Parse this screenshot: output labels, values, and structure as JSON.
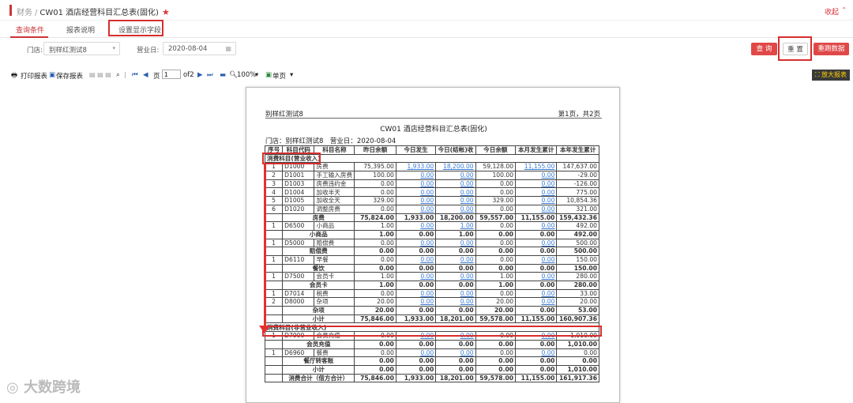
{
  "header": {
    "crumb1": "财务",
    "sep": "/",
    "title": "CW01 酒店经营科目汇总表(固化)",
    "collapse": "收起"
  },
  "tabs": [
    "查询条件",
    "报表说明",
    "设置显示字段"
  ],
  "filters": {
    "store_label": "门店:",
    "store_value": "别样红测试8",
    "date_label": "营业日:",
    "date_value": "2020-08-04"
  },
  "buttons": {
    "query": "查 询",
    "reset": "重 置",
    "rerun": "重跑数据"
  },
  "toolbar": {
    "print": "打印报表",
    "save": "保存报表",
    "page_label": "页",
    "page_value": "1",
    "of": "of2",
    "zoom": "100%",
    "single": "单页",
    "enlarge": "放大报表"
  },
  "report": {
    "store": "别样红测试8",
    "page_info": "第1页，共2页",
    "title": "CW01 酒店经营科目汇总表(固化)",
    "meta": "门店：别样红测试8　营业日：2020-08-04",
    "columns": [
      "序号",
      "科目代码",
      "科目名称",
      "昨日余额",
      "今日发生",
      "今日(结帐)收",
      "今日余额",
      "本月发生累计",
      "本年发生累计"
    ],
    "rows": [
      {
        "t": "sect",
        "label": "消费科目(营业收入)"
      },
      {
        "t": "d",
        "c": [
          "1",
          "D1000",
          "房费",
          "75,395.00",
          "1,933.00",
          "18,200.00",
          "59,128.00",
          "11,155.00",
          "147,637.00"
        ]
      },
      {
        "t": "d",
        "c": [
          "2",
          "D1001",
          "手工输入房费",
          "100.00",
          "0.00",
          "0.00",
          "100.00",
          "0.00",
          "-29.00"
        ]
      },
      {
        "t": "d",
        "c": [
          "3",
          "D1003",
          "房费违约金",
          "0.00",
          "0.00",
          "0.00",
          "0.00",
          "0.00",
          "-126.00"
        ]
      },
      {
        "t": "d",
        "c": [
          "4",
          "D1004",
          "加收半天",
          "0.00",
          "0.00",
          "0.00",
          "0.00",
          "0.00",
          "775.00"
        ]
      },
      {
        "t": "d",
        "c": [
          "5",
          "D1005",
          "加收全天",
          "329.00",
          "0.00",
          "0.00",
          "329.00",
          "0.00",
          "10,854.36"
        ]
      },
      {
        "t": "d",
        "c": [
          "6",
          "D1020",
          "调整房费",
          "0.00",
          "0.00",
          "0.00",
          "0.00",
          "0.00",
          "321.00"
        ]
      },
      {
        "t": "s",
        "label": "房费",
        "c": [
          "75,824.00",
          "1,933.00",
          "18,200.00",
          "59,557.00",
          "11,155.00",
          "159,432.36"
        ]
      },
      {
        "t": "d",
        "c": [
          "1",
          "D6500",
          "小商品",
          "1.00",
          "0.00",
          "1.00",
          "0.00",
          "0.00",
          "492.00"
        ]
      },
      {
        "t": "s",
        "label": "小商品",
        "c": [
          "1.00",
          "0.00",
          "1.00",
          "0.00",
          "0.00",
          "492.00"
        ]
      },
      {
        "t": "d",
        "c": [
          "1",
          "D5000",
          "赔偿费",
          "0.00",
          "0.00",
          "0.00",
          "0.00",
          "0.00",
          "500.00"
        ]
      },
      {
        "t": "s",
        "label": "赔偿费",
        "c": [
          "0.00",
          "0.00",
          "0.00",
          "0.00",
          "0.00",
          "500.00"
        ]
      },
      {
        "t": "d",
        "c": [
          "1",
          "D6110",
          "早餐",
          "0.00",
          "0.00",
          "0.00",
          "0.00",
          "0.00",
          "150.00"
        ]
      },
      {
        "t": "s",
        "label": "餐饮",
        "c": [
          "0.00",
          "0.00",
          "0.00",
          "0.00",
          "0.00",
          "150.00"
        ]
      },
      {
        "t": "d",
        "c": [
          "1",
          "D7500",
          "会员卡",
          "1.00",
          "0.00",
          "0.00",
          "1.00",
          "0.00",
          "280.00"
        ]
      },
      {
        "t": "s",
        "label": "会员卡",
        "c": [
          "1.00",
          "0.00",
          "0.00",
          "1.00",
          "0.00",
          "280.00"
        ]
      },
      {
        "t": "d",
        "c": [
          "1",
          "D7014",
          "税费",
          "0.00",
          "0.00",
          "0.00",
          "0.00",
          "0.00",
          "33.00"
        ]
      },
      {
        "t": "d",
        "c": [
          "2",
          "D8000",
          "杂项",
          "20.00",
          "0.00",
          "0.00",
          "20.00",
          "0.00",
          "20.00"
        ]
      },
      {
        "t": "s",
        "label": "杂项",
        "c": [
          "20.00",
          "0.00",
          "0.00",
          "20.00",
          "0.00",
          "53.00"
        ]
      },
      {
        "t": "s",
        "label": "小计",
        "c": [
          "75,846.00",
          "1,933.00",
          "18,201.00",
          "59,578.00",
          "11,155.00",
          "160,907.36"
        ]
      },
      {
        "t": "sect",
        "label": "消费科目(非营业收入)"
      },
      {
        "t": "d",
        "c": [
          "1",
          "D7900",
          "会员充值",
          "0.00",
          "0.00",
          "0.00",
          "0.00",
          "0.00",
          "1,010.00"
        ]
      },
      {
        "t": "s",
        "label": "会员充值",
        "c": [
          "0.00",
          "0.00",
          "0.00",
          "0.00",
          "0.00",
          "1,010.00"
        ]
      },
      {
        "t": "d",
        "c": [
          "1",
          "D6960",
          "餐费",
          "0.00",
          "0.00",
          "0.00",
          "0.00",
          "0.00",
          "0.00"
        ]
      },
      {
        "t": "s",
        "label": "餐厅转客账",
        "c": [
          "0.00",
          "0.00",
          "0.00",
          "0.00",
          "0.00",
          "0.00"
        ]
      },
      {
        "t": "s",
        "label": "小计",
        "c": [
          "0.00",
          "0.00",
          "0.00",
          "0.00",
          "0.00",
          "1,010.00"
        ]
      },
      {
        "t": "s",
        "label": "消费合计（借方合计）",
        "c": [
          "75,846.00",
          "1,933.00",
          "18,201.00",
          "59,578.00",
          "11,155.00",
          "161,917.36"
        ]
      }
    ]
  },
  "watermark": "大数跨境"
}
